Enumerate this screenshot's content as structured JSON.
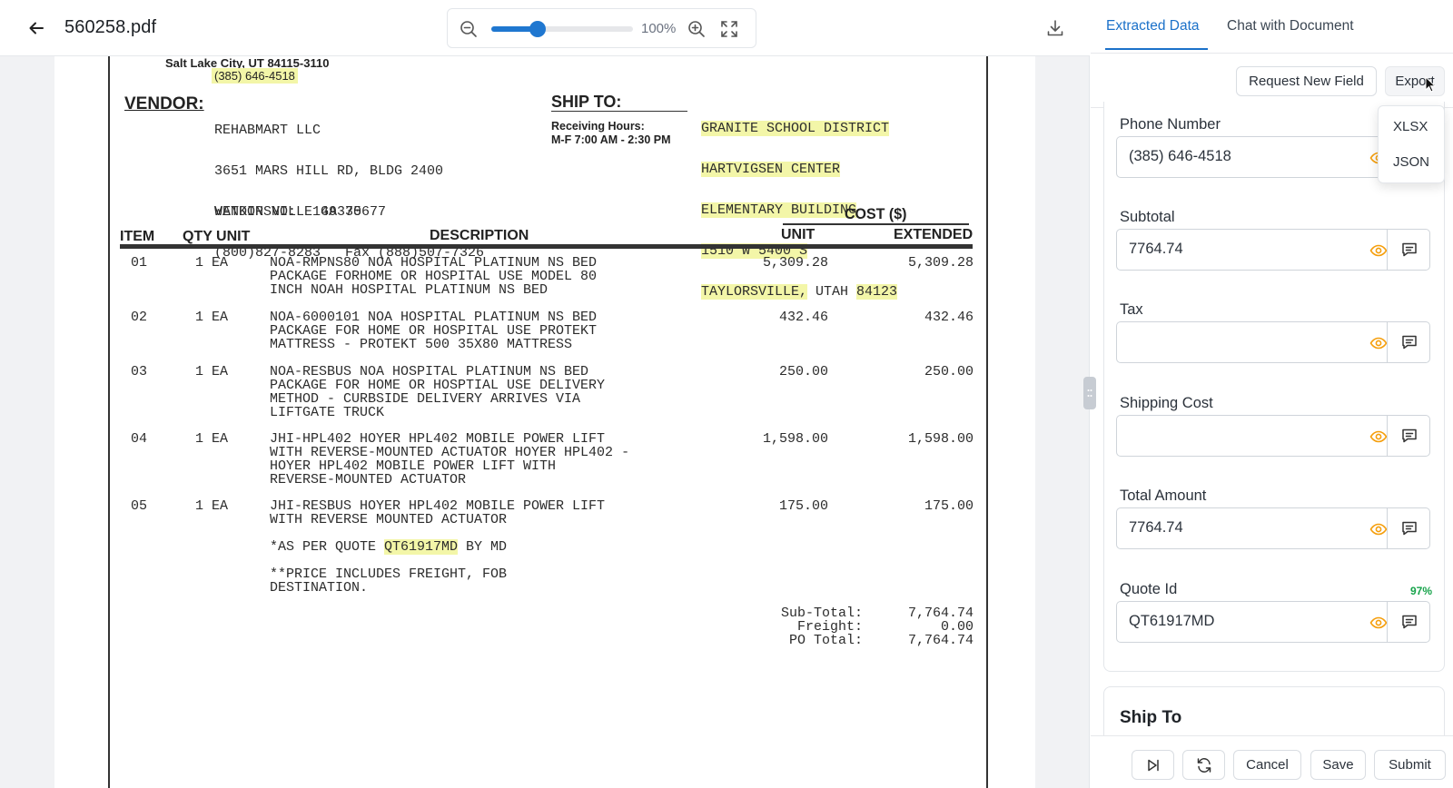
{
  "viewer": {
    "file_name": "560258.pdf",
    "zoom_level": "100%",
    "zoom_slider_fraction": 0.33
  },
  "document": {
    "header_city": "Salt Lake City, UT  84115-3110",
    "header_phone": "(385) 646-4518",
    "vendor_label": "VENDOR:",
    "vendor_lines": [
      "REHABMART LLC",
      "3651 MARS HILL RD, BLDG 2400",
      "WATKINSVILLE GA 30677"
    ],
    "ship_to_label": "SHIP TO:",
    "receiving_hours": [
      "Receiving Hours:",
      "M-F  7:00 AM - 2:30 PM"
    ],
    "ship_to_lines": [
      "GRANITE SCHOOL DISTRICT",
      "HARTVIGSEN CENTER",
      "ELEMENTARY BUILDING",
      "1510 W 5400 S",
      "TAYLORSVILLE,",
      " UTAH ",
      "84123"
    ],
    "vendor_no": "VENDOR NO:  149375",
    "vendor_contact": "(800)827-8283   Fax (888)507-7326",
    "cost_header": "COST ($)",
    "columns": {
      "item": "ITEM",
      "qty_unit": "QTY UNIT",
      "description": "DESCRIPTION",
      "unit": "UNIT",
      "extended": "EXTENDED"
    },
    "line_items": [
      {
        "item": "01",
        "qty": "1 EA",
        "description": "NOA-RMPNS80 NOA HOSPITAL PLATINUM NS BED\nPACKAGE FORHOME OR HOSPITAL USE MODEL 80\nINCH NOAH HOSPITAL PLATINUM NS BED",
        "unit": "5,309.28",
        "extended": "5,309.28"
      },
      {
        "item": "02",
        "qty": "1 EA",
        "description": "NOA-6000101 NOA HOSPITAL PLATINUM NS BED\nPACKAGE FOR HOME OR HOSPITAL USE PROTEKT\nMATTRESS - PROTEKT 500 35X80 MATTRESS",
        "unit": "432.46",
        "extended": "432.46"
      },
      {
        "item": "03",
        "qty": "1 EA",
        "description": "NOA-RESBUS NOA HOSPITAL PLATINUM NS BED\nPACKAGE FOR HOME OR HOSPTIAL USE DELIVERY\nMETHOD - CURBSIDE DELIVERY ARRIVES VIA\nLIFTGATE TRUCK",
        "unit": "250.00",
        "extended": "250.00"
      },
      {
        "item": "04",
        "qty": "1 EA",
        "description": "JHI-HPL402 HOYER HPL402 MOBILE POWER LIFT\nWITH REVERSE-MOUNTED ACTUATOR HOYER HPL402 -\nHOYER HPL402 MOBILE POWER LIFT WITH\nREVERSE-MOUNTED ACTUATOR",
        "unit": "1,598.00",
        "extended": "1,598.00"
      },
      {
        "item": "05",
        "qty": "1 EA",
        "description": "JHI-RESBUS HOYER HPL402 MOBILE POWER LIFT\nWITH REVERSE MOUNTED ACTUATOR",
        "unit": "175.00",
        "extended": "175.00"
      }
    ],
    "note_quote_prefix": "*AS PER QUOTE ",
    "note_quote_id": "QT61917MD",
    "note_quote_suffix": " BY MD",
    "note_freight": "**PRICE INCLUDES FREIGHT, FOB\nDESTINATION.",
    "totals_labels": "Sub-Total:\nFreight:\nPO Total:",
    "totals_values": "7,764.74\n0.00\n7,764.74"
  },
  "panel": {
    "tabs": {
      "extracted": "Extracted Data",
      "chat": "Chat with Document"
    },
    "request_button": "Request New Field",
    "export_button": "Export",
    "export_menu": [
      "XLSX",
      "JSON"
    ],
    "fields": [
      {
        "label": "Phone Number",
        "value": "(385) 646-4518",
        "confidence": ""
      },
      {
        "label": "Subtotal",
        "value": "7764.74",
        "confidence": ""
      },
      {
        "label": "Tax",
        "value": "",
        "confidence": ""
      },
      {
        "label": "Shipping Cost",
        "value": "",
        "confidence": ""
      },
      {
        "label": "Total Amount",
        "value": "7764.74",
        "confidence": ""
      },
      {
        "label": "Quote Id",
        "value": "QT61917MD",
        "confidence": "97%"
      }
    ],
    "section_title": "Ship To",
    "footer": {
      "cancel": "Cancel",
      "save": "Save",
      "submit": "Submit"
    }
  },
  "colors": {
    "accent": "#1b71c9",
    "highlight": "#f3f6a8",
    "eye_icon": "#f59e0b",
    "confidence": "#16a34a"
  },
  "icons": [
    "back-arrow-icon",
    "zoom-out-icon",
    "zoom-in-icon",
    "fullscreen-icon",
    "download-icon",
    "eye-icon",
    "comment-icon",
    "skip-icon",
    "refresh-icon"
  ]
}
